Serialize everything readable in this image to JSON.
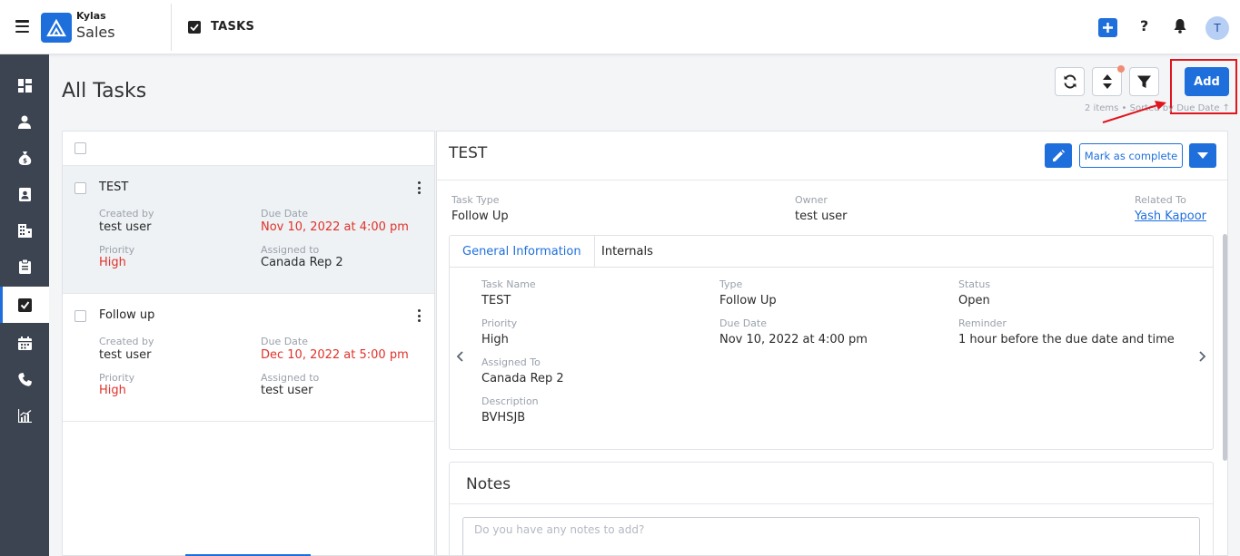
{
  "brand": {
    "line1": "Kylas",
    "line2": "Sales"
  },
  "module": {
    "label": "TASKS"
  },
  "topbar": {
    "help_label": "?",
    "avatar_initial": "T"
  },
  "page": {
    "title": "All Tasks",
    "add_label": "Add",
    "meta": "2 items • Sorted by Due Date ↑"
  },
  "tasks": [
    {
      "title": "TEST",
      "created_by_label": "Created by",
      "created_by": "test user",
      "due_label": "Due Date",
      "due": "Nov 10, 2022 at 4:00 pm",
      "priority_label": "Priority",
      "priority": "High",
      "assigned_label": "Assigned to",
      "assigned": "Canada Rep 2"
    },
    {
      "title": "Follow up",
      "created_by_label": "Created by",
      "created_by": "test user",
      "due_label": "Due Date",
      "due": "Dec 10, 2022 at 5:00 pm",
      "priority_label": "Priority",
      "priority": "High",
      "assigned_label": "Assigned to",
      "assigned": "test user"
    }
  ],
  "detail": {
    "title": "TEST",
    "mark_complete_label": "Mark as complete",
    "summary": {
      "task_type_label": "Task Type",
      "task_type": "Follow Up",
      "owner_label": "Owner",
      "owner": "test user",
      "related_label": "Related To",
      "related": "Yash Kapoor"
    },
    "tabs": [
      "General Information",
      "Internals"
    ],
    "general": {
      "task_name_label": "Task Name",
      "task_name": "TEST",
      "type_label": "Type",
      "type": "Follow Up",
      "status_label": "Status",
      "status": "Open",
      "priority_label": "Priority",
      "priority": "High",
      "due_label": "Due Date",
      "due": "Nov 10, 2022 at 4:00 pm",
      "reminder_label": "Reminder",
      "reminder": "1 hour before the due date and time",
      "assigned_label": "Assigned To",
      "assigned": "Canada Rep 2",
      "description_label": "Description",
      "description": "BVHSJB"
    },
    "notes": {
      "title": "Notes",
      "placeholder": "Do you have any notes to add?"
    }
  },
  "colors": {
    "accent": "#1e6fdc",
    "sidebar": "#3c4452",
    "danger": "#e0322a",
    "highlight": "#e0151d"
  }
}
